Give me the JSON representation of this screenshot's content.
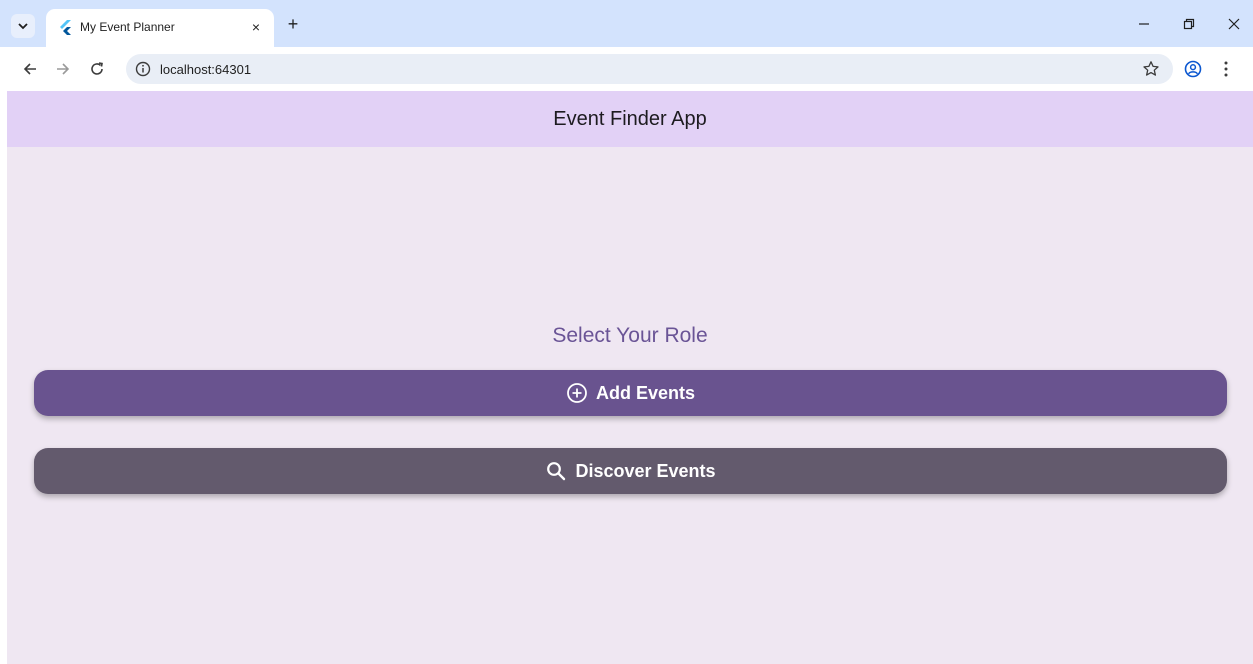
{
  "browser": {
    "tab": {
      "title": "My Event Planner",
      "close_glyph": "×"
    },
    "new_tab_glyph": "+",
    "address": {
      "url": "localhost:64301"
    }
  },
  "app": {
    "appbar_title": "Event Finder App",
    "heading": "Select Your Role",
    "buttons": [
      {
        "label": "Add Events",
        "icon": "add-circle-icon",
        "color": "#69538f"
      },
      {
        "label": "Discover Events",
        "icon": "search-icon",
        "color": "#635a6d"
      }
    ],
    "colors": {
      "appbar": "#e2d1f6",
      "background": "#efe7f2",
      "heading": "#6a5496"
    }
  }
}
